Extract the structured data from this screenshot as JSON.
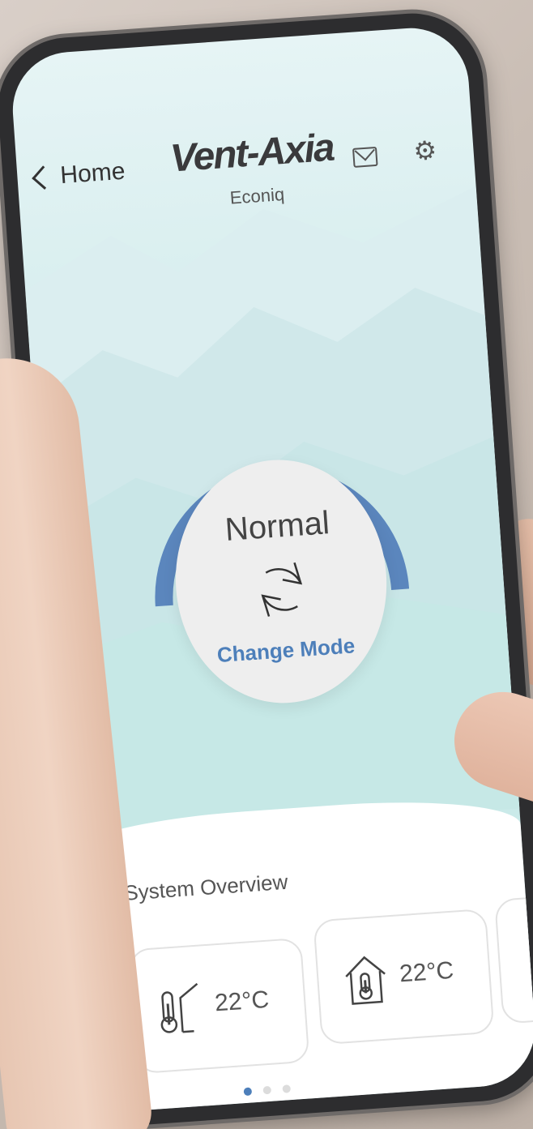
{
  "header": {
    "back_label": "Home",
    "logo_text": "Vent-Axia",
    "subtitle": "Econiq"
  },
  "dial": {
    "mode_label": "Normal",
    "change_mode_label": "Change Mode",
    "accent_color": "#5b86bd"
  },
  "overview": {
    "title": "System Overview",
    "cards": [
      {
        "icon": "outdoor-temperature-icon",
        "value": "22°C"
      },
      {
        "icon": "indoor-temperature-icon",
        "value": "22°C"
      }
    ],
    "pagination": {
      "pages": 3,
      "active": 1
    }
  },
  "colors": {
    "accent": "#4d7fba",
    "screen_bg": "#d2ecec"
  }
}
